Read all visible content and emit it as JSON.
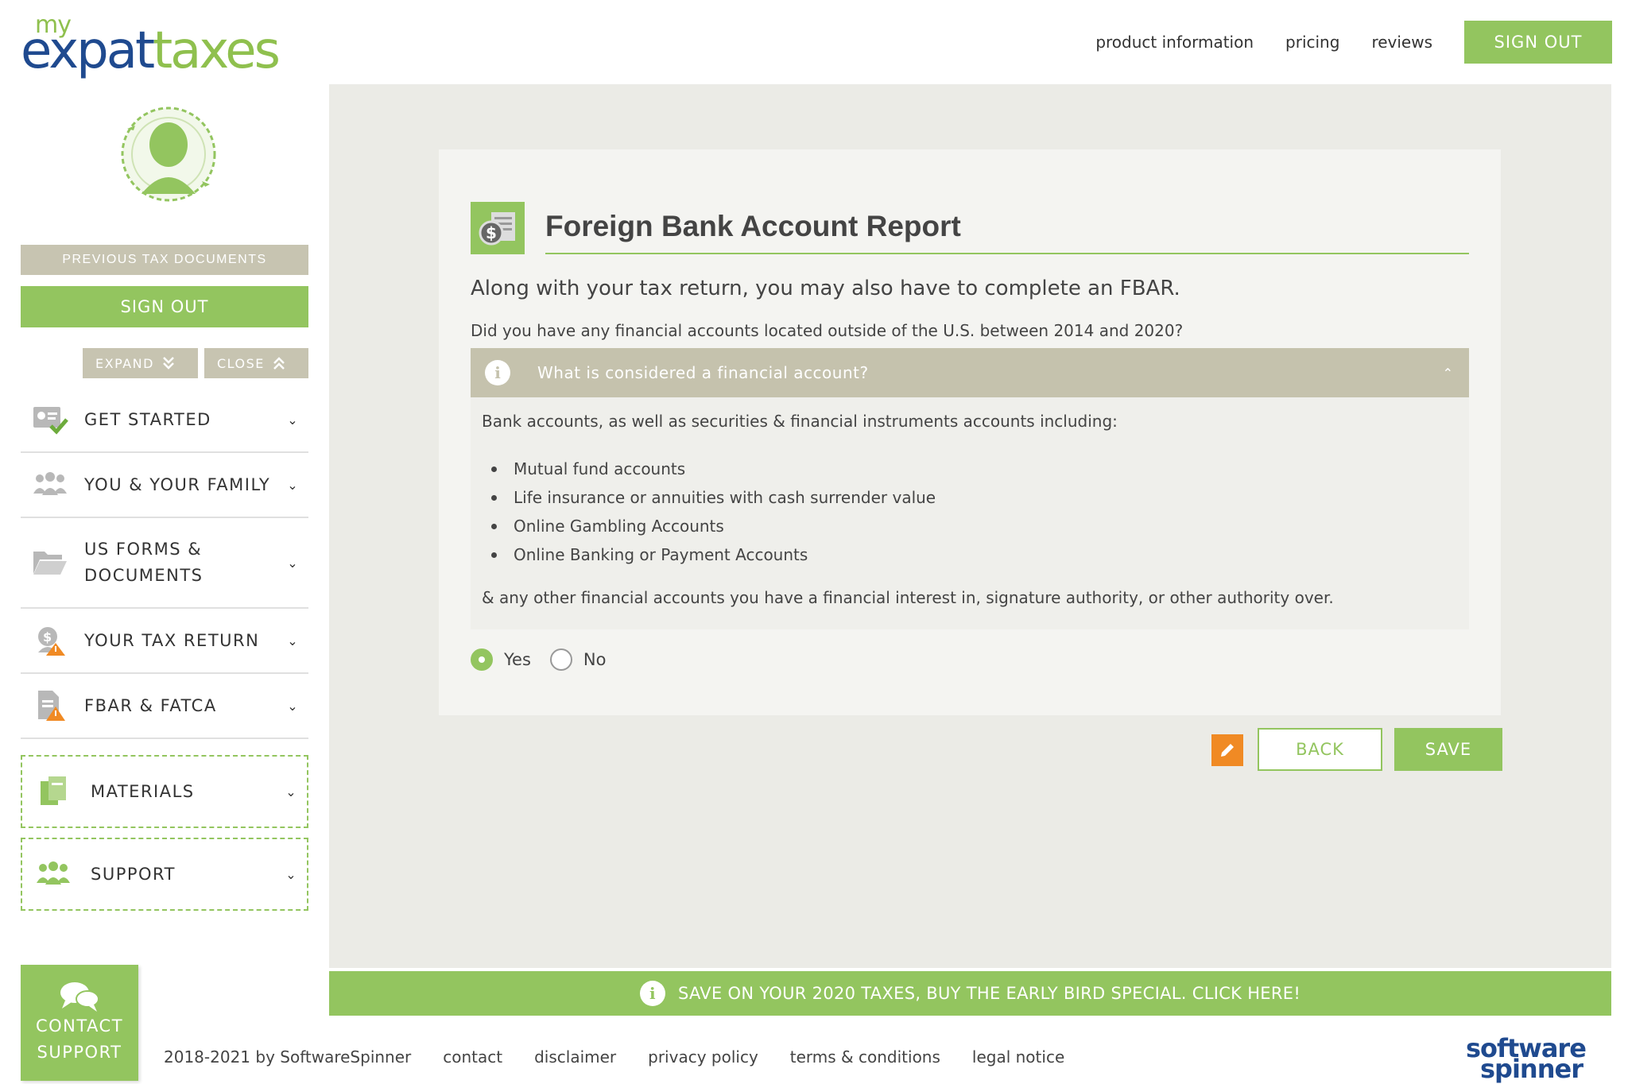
{
  "header": {
    "logo": {
      "my": "my",
      "expat": "expat",
      "taxes": "taxes"
    },
    "nav": [
      "product information",
      "pricing",
      "reviews"
    ],
    "sign_out": "SIGN OUT"
  },
  "sidebar": {
    "previous_docs": "PREVIOUS TAX DOCUMENTS",
    "sign_out": "SIGN OUT",
    "expand": "EXPAND",
    "close": "CLOSE",
    "items": [
      {
        "label": "GET STARTED",
        "icon": "id-card-check-icon"
      },
      {
        "label": "YOU & YOUR FAMILY",
        "icon": "family-icon"
      },
      {
        "label": "US FORMS & DOCUMENTS",
        "icon": "folder-open-icon"
      },
      {
        "label": "YOUR TAX RETURN",
        "icon": "tax-return-warning-icon"
      },
      {
        "label": "FBAR & FATCA",
        "icon": "document-warning-icon"
      }
    ],
    "materials": "MATERIALS",
    "support": "SUPPORT",
    "contact_support_line1": "CONTACT",
    "contact_support_line2": "SUPPORT"
  },
  "card": {
    "title_bold": "Foreign",
    "title_rest": " Bank Account Report",
    "intro": "Along with your tax return, you may also have to complete an FBAR.",
    "question": "Did you have any financial accounts located outside of the U.S. between 2014 and 2020?",
    "accordion_title": "What is considered a financial account?",
    "accordion_intro": "Bank accounts, as well as securities & financial instruments accounts including:",
    "accordion_list": [
      "Mutual fund accounts",
      "Life insurance or annuities with cash surrender value",
      "Online Gambling Accounts",
      "Online Banking or Payment Accounts"
    ],
    "accordion_tail": "& any other financial accounts you have a financial interest in, signature authority, or other authority over.",
    "options": {
      "yes": "Yes",
      "no": "No",
      "selected": "Yes"
    }
  },
  "actions": {
    "back": "BACK",
    "save": "SAVE"
  },
  "banner": "SAVE ON YOUR 2020 TAXES, BUY THE EARLY BIRD SPECIAL. CLICK HERE!",
  "footer": {
    "copyright": "2018-2021 by SoftwareSpinner",
    "links": [
      "contact",
      "disclaimer",
      "privacy policy",
      "terms & conditions",
      "legal notice"
    ]
  },
  "partner_logo": {
    "line1": "software",
    "line2": "spinner"
  },
  "colors": {
    "accent_green": "#93c55f",
    "brand_blue": "#1f4a8f",
    "khaki": "#c5c2ad",
    "orange": "#f08a24"
  }
}
